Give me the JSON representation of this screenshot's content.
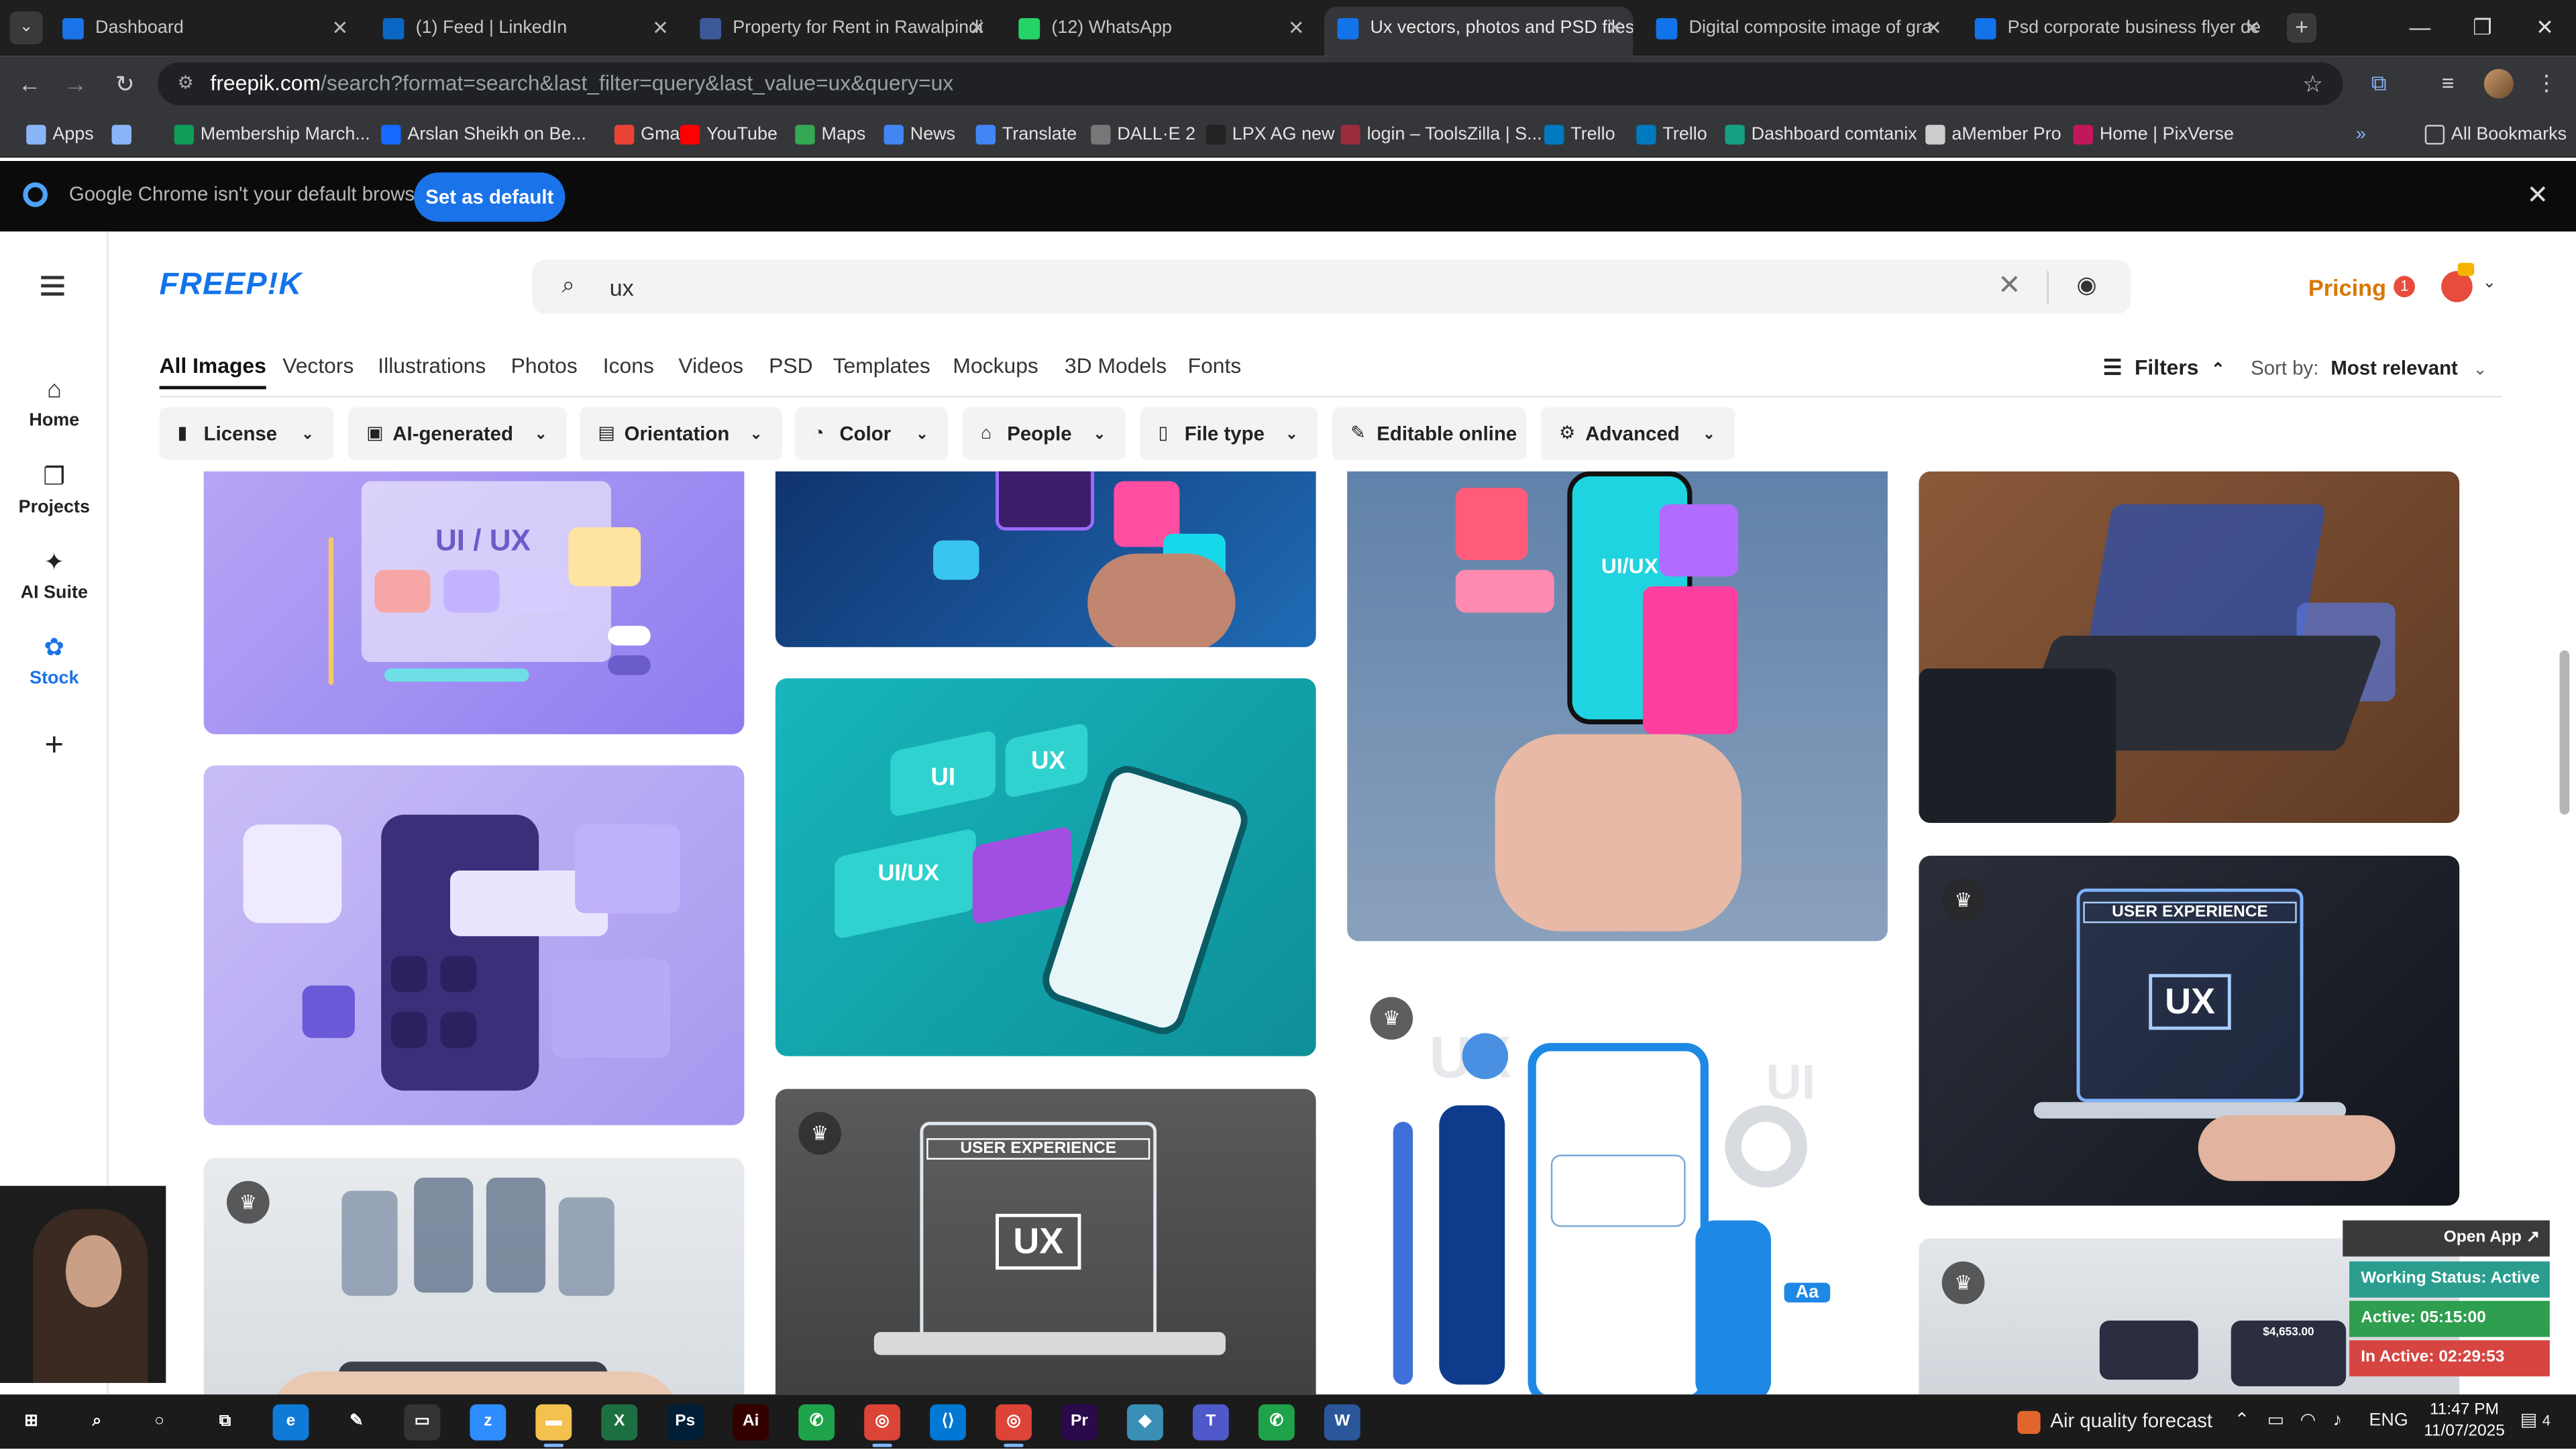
{
  "browser": {
    "tabs": [
      {
        "title": "Dashboard",
        "favicon_color": "#1a73e8",
        "active": false
      },
      {
        "title": "(1) Feed | LinkedIn",
        "favicon_color": "#0a66c2",
        "active": false
      },
      {
        "title": "Property for Rent in Rawalpindi",
        "favicon_color": "#3b5998",
        "active": false
      },
      {
        "title": "(12) WhatsApp",
        "favicon_color": "#25d366",
        "active": false
      },
      {
        "title": "Ux vectors, photos and PSD files",
        "favicon_color": "#1273eb",
        "active": true
      },
      {
        "title": "Digital composite image of gra",
        "favicon_color": "#1273eb",
        "active": false
      },
      {
        "title": "Psd corporate business flyer de",
        "favicon_color": "#1273eb",
        "active": false
      }
    ],
    "tab_close": "✕",
    "new_tab": "+",
    "window": {
      "minimize": "—",
      "restore": "❐",
      "close": "✕"
    },
    "url_host": "freepik.com",
    "url_path": "/search?format=search&last_filter=query&last_value=ux&query=ux",
    "bookmarks": [
      {
        "label": "Apps",
        "color": "#8ab4f8"
      },
      {
        "label": "",
        "color": "#8ab4f8"
      },
      {
        "label": "Membership March...",
        "color": "#0f9d58"
      },
      {
        "label": "Arslan Sheikh on Be...",
        "color": "#1769ff"
      },
      {
        "label": "Gmail",
        "color": "#ea4335"
      },
      {
        "label": "YouTube",
        "color": "#ff0000"
      },
      {
        "label": "Maps",
        "color": "#34a853"
      },
      {
        "label": "News",
        "color": "#4285f4"
      },
      {
        "label": "Translate",
        "color": "#4285f4"
      },
      {
        "label": "DALL·E 2",
        "color": "#777777"
      },
      {
        "label": "LPX AG new",
        "color": "#222222"
      },
      {
        "label": "login – ToolsZilla | S...",
        "color": "#9b2c3a"
      },
      {
        "label": "Trello",
        "color": "#0079bf"
      },
      {
        "label": "Trello",
        "color": "#0079bf"
      },
      {
        "label": "Dashboard comtanix",
        "color": "#16a085"
      },
      {
        "label": "aMember Pro",
        "color": "#cccccc"
      },
      {
        "label": "Home | PixVerse",
        "color": "#c2185b"
      }
    ],
    "all_bookmarks": "All Bookmarks",
    "more_bookmarks": "»"
  },
  "infobar": {
    "message": "Google Chrome isn't your default browser",
    "button": "Set as default",
    "close": "✕"
  },
  "leftnav": [
    {
      "label": "Home",
      "icon": "⌂",
      "active": false
    },
    {
      "label": "Projects",
      "icon": "❐",
      "active": false
    },
    {
      "label": "AI Suite",
      "icon": "✦",
      "active": false
    },
    {
      "label": "Stock",
      "icon": "✿",
      "active": true
    }
  ],
  "leftnav_add": "+",
  "header": {
    "logo": "FREEP!K",
    "search_value": "ux",
    "search_icon": "⌕",
    "clear_icon": "✕",
    "camera_icon": "◉",
    "pricing": "Pricing",
    "notifications": "1",
    "user_chevron": "⌄"
  },
  "categories": [
    "All Images",
    "Vectors",
    "Illustrations",
    "Photos",
    "Icons",
    "Videos",
    "PSD",
    "Templates",
    "Mockups",
    "3D Models",
    "Fonts"
  ],
  "filters": {
    "label": "Filters",
    "icon": "☰",
    "chevron": "⌃"
  },
  "sort": {
    "label": "Sort by:",
    "value": "Most relevant",
    "chevron": "⌄"
  },
  "chips": [
    {
      "label": "License",
      "icon": "▮"
    },
    {
      "label": "AI-generated",
      "icon": "▣"
    },
    {
      "label": "Orientation",
      "icon": "▤"
    },
    {
      "label": "Color",
      "icon": "◔"
    },
    {
      "label": "People",
      "icon": "⌂"
    },
    {
      "label": "File type",
      "icon": "▯"
    },
    {
      "label": "Editable online",
      "icon": "✎"
    },
    {
      "label": "Advanced",
      "icon": "⚙"
    }
  ],
  "chip_chevron": "⌄",
  "tiles": {
    "t1_text": "UI / UX",
    "t5_a": "UI",
    "t5_b": "UX",
    "t5_c": "UI/UX",
    "t8_text": "UI/UX",
    "t10_title": "USER EXPERIENCE",
    "t10_big": "UX",
    "t6_title": "USER EXPERIENCE",
    "t6_big": "UX",
    "t9_a": "UX",
    "t9_b": "UI",
    "t9_aa": "Aa",
    "t3_amount": "$4,653.00",
    "crown": "♛"
  },
  "status_widget": {
    "open_app": "Open App ↗",
    "working": "Working Status: Active",
    "active": "Active: 05:15:00",
    "inactive": "In Active: 02:29:53",
    "colors": {
      "working": "#2a9d8f",
      "active": "#2e9e4f",
      "inactive": "#d64541"
    }
  },
  "taskbar": {
    "apps": [
      {
        "name": "start",
        "glyph": "⊞",
        "color": "transparent"
      },
      {
        "name": "search",
        "glyph": "⌕",
        "color": "transparent"
      },
      {
        "name": "cortana",
        "glyph": "○",
        "color": "transparent"
      },
      {
        "name": "task-view",
        "glyph": "⧉",
        "color": "transparent"
      },
      {
        "name": "edge",
        "glyph": "e",
        "color": "#0f7bd6"
      },
      {
        "name": "pen",
        "glyph": "✎",
        "color": "transparent"
      },
      {
        "name": "terminal",
        "glyph": "▭",
        "color": "#333333"
      },
      {
        "name": "zoom",
        "glyph": "z",
        "color": "#2d8cff"
      },
      {
        "name": "explorer",
        "glyph": "▬",
        "color": "#f2c14e"
      },
      {
        "name": "excel",
        "glyph": "X",
        "color": "#1d6f42"
      },
      {
        "name": "photoshop",
        "glyph": "Ps",
        "color": "#001e36"
      },
      {
        "name": "illustrator",
        "glyph": "Ai",
        "color": "#330000"
      },
      {
        "name": "app-green",
        "glyph": "✆",
        "color": "#1fa34a"
      },
      {
        "name": "chrome",
        "glyph": "◎",
        "color": "#db4437"
      },
      {
        "name": "vscode",
        "glyph": "⟨⟩",
        "color": "#0078d4"
      },
      {
        "name": "chrome-active",
        "glyph": "◎",
        "color": "#db4437"
      },
      {
        "name": "premiere",
        "glyph": "Pr",
        "color": "#2a0a4a"
      },
      {
        "name": "app-blue",
        "glyph": "◆",
        "color": "#3a8fb7"
      },
      {
        "name": "teams",
        "glyph": "T",
        "color": "#5059c9"
      },
      {
        "name": "app-green2",
        "glyph": "✆",
        "color": "#1fa34a"
      },
      {
        "name": "word",
        "glyph": "W",
        "color": "#2b579a"
      }
    ],
    "weather": "Air quality forecast",
    "lang": "ENG",
    "time": "11:47 PM",
    "date": "11/07/2025",
    "notifications": "4"
  }
}
